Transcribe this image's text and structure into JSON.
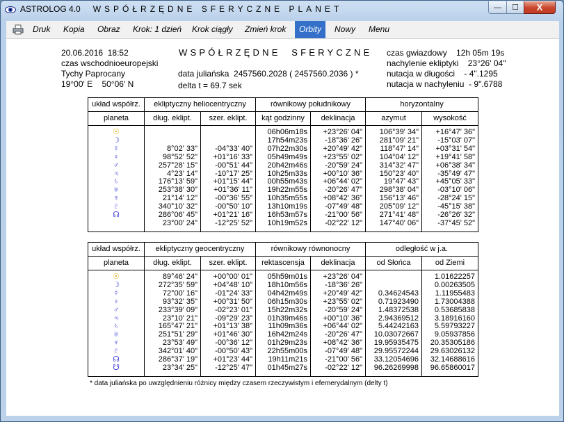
{
  "window": {
    "app_name": "ASTROLOG 4.0",
    "title": "WSPÓŁRZĘDNE SFERYCZNE PLANET",
    "min_label": "—",
    "max_label": "☐",
    "close_label": "X"
  },
  "menu": [
    "Druk",
    "Kopia",
    "Obraz",
    "Krok: 1 dzień",
    "Krok ciągły",
    "Zmień krok",
    "Orbity",
    "Nowy",
    "Menu"
  ],
  "header": {
    "date_time": "20.06.2016  18:52",
    "timezone": "czas wschodnioeuropejski",
    "place": "Tychy Paprocany",
    "coords": "19°00' E    50°06' N",
    "main_title": "WSPÓŁRZĘDNE  SFERYCZNE",
    "julian": "data juliańska  2457560.2028 ( 2457560.2036 ) *",
    "delta_t": "delta t = 69.7 sek",
    "sidereal": "czas gwiazdowy    12h 05m 19s",
    "ecliptic_incl": "nachylenie ekliptyki    23°26' 04\"",
    "nutation_long": "nutacja w długości    - 4\".1295",
    "nutation_incl": "nutacja w nachyleniu  - 9\".6788"
  },
  "table1": {
    "header_top": [
      "układ współrz.",
      "ekliptyczny heliocentryczny",
      "równikowy południkowy",
      "horyzontalny"
    ],
    "header_sub": [
      "planeta",
      "dług. eklipt.",
      "szer. eklipt.",
      "kąt godzinny",
      "deklinacja",
      "azymut",
      "wysokość"
    ],
    "planets": [
      "☉",
      "☽",
      "☿",
      "♀",
      "♂",
      "♃",
      "♄",
      "♅",
      "♆",
      "♇",
      "☊"
    ],
    "columns": [
      [
        "",
        "",
        "8°02' 33\"",
        "98°52' 52\"",
        "257°28' 15\"",
        "4°23' 14\"",
        "176°13' 59\"",
        "253°38' 30\"",
        "21°14' 12\"",
        "340°10' 32\"",
        "286°06' 45\"",
        "23°00' 24\""
      ],
      [
        "",
        "",
        "-04°33' 40\"",
        "+01°16' 33\"",
        "-00°51' 44\"",
        "-10°17' 25\"",
        "+01°15' 44\"",
        "+01°36' 11\"",
        "-00°36' 55\"",
        "-00°50' 10\"",
        "+01°21' 16\"",
        "-12°25' 52\""
      ],
      [
        "06h06m18s",
        "17h54m23s",
        "07h22m30s",
        "05h49m49s",
        "20h42m46s",
        "10h25m33s",
        "00h55m43s",
        "19h22m55s",
        "10h35m55s",
        "13h10m19s",
        "16h53m57s",
        "10h19m52s"
      ],
      [
        "+23°26' 04\"",
        "-18°36' 26\"",
        "+20°49' 42\"",
        "+23°55' 02\"",
        "-20°59' 24\"",
        "+00°10' 36\"",
        "+06°44' 02\"",
        "-20°26' 47\"",
        "+08°42' 36\"",
        "-07°49' 48\"",
        "-21°00' 56\"",
        "-02°22' 12\""
      ],
      [
        "106°39' 34\"",
        "281°09' 21\"",
        "118°47' 14\"",
        "104°04' 12\"",
        "314°32' 47\"",
        "150°23' 40\"",
        "19°47' 43\"",
        "298°38' 04\"",
        "156°13' 46\"",
        "205°09' 12\"",
        "271°41' 48\"",
        "147°40' 06\""
      ],
      [
        "+16°47' 36\"",
        "-15°03' 07\"",
        "+03°31' 54\"",
        "+19°41' 58\"",
        "+06°38' 34\"",
        "-35°49' 47\"",
        "+45°05' 33\"",
        "-03°10' 06\"",
        "-28°24' 15\"",
        "-45°15' 38\"",
        "-26°26' 32\"",
        "-37°45' 52\""
      ]
    ]
  },
  "table2": {
    "header_top": [
      "układ współrz.",
      "ekliptyczny geocentryczny",
      "równikowy równonocny",
      "odległość  w  j.a."
    ],
    "header_sub": [
      "planeta",
      "dług. eklipt.",
      "szer. eklipt.",
      "rektascensja",
      "deklinacja",
      "od Słońca",
      "od Ziemi"
    ],
    "planets": [
      "☉",
      "☽",
      "☿",
      "♀",
      "♂",
      "♃",
      "♄",
      "♅",
      "♆",
      "♇",
      "☊",
      "☋"
    ],
    "columns": [
      [
        "89°46' 24\"",
        "272°35' 59\"",
        "72°00' 16\"",
        "93°32' 35\"",
        "233°39' 09\"",
        "23°10' 21\"",
        "165°47' 21\"",
        "251°51' 29\"",
        "23°53' 49\"",
        "342°01' 40\"",
        "286°37' 19\"",
        "23°34' 25\""
      ],
      [
        "+00°00' 01\"",
        "+04°48' 10\"",
        "-01°24' 33\"",
        "+00°31' 50\"",
        "-02°23' 01\"",
        "-09°29' 23\"",
        "+01°13' 38\"",
        "+01°46' 30\"",
        "-00°36' 12\"",
        "-00°50' 43\"",
        "+01°23' 44\"",
        "-12°25' 47\""
      ],
      [
        "05h59m01s",
        "18h10m56s",
        "04h42m49s",
        "06h15m30s",
        "15h22m32s",
        "01h39m46s",
        "11h09m36s",
        "16h42m24s",
        "01h29m23s",
        "22h55m00s",
        "19h11m21s",
        "01h45m27s"
      ],
      [
        "+23°26' 04\"",
        "-18°36' 26\"",
        "+20°49' 42\"",
        "+23°55' 02\"",
        "-20°59' 24\"",
        "+00°10' 36\"",
        "+06°44' 02\"",
        "-20°26' 47\"",
        "+08°42' 36\"",
        "-07°49' 48\"",
        "-21°00' 56\"",
        "-02°22' 12\""
      ],
      [
        "",
        "",
        "0.34624543",
        "0.71923490",
        "1.48372538",
        "2.94369512",
        "5.44242163",
        "10.03072667",
        "19.95935475",
        "29.95572244",
        "33.12054696",
        "96.26269998"
      ],
      [
        "1.01622257",
        "0.00263505",
        "1.11955483",
        "1.73004388",
        "0.53685838",
        "3.18916160",
        "5.59793227",
        "9.05937856",
        "20.35305186",
        "29.63026132",
        "32.14688616",
        "96.65860017"
      ]
    ]
  },
  "footnote": "* data juliańska po uwzględnieniu różnicy między czasem rzeczywistym i efemerydalnym (delty t)",
  "colors": {
    "sun_symbol": "#d6a400",
    "planet_symbol": "#3b3bd8",
    "menu_active": "#3470c9"
  }
}
